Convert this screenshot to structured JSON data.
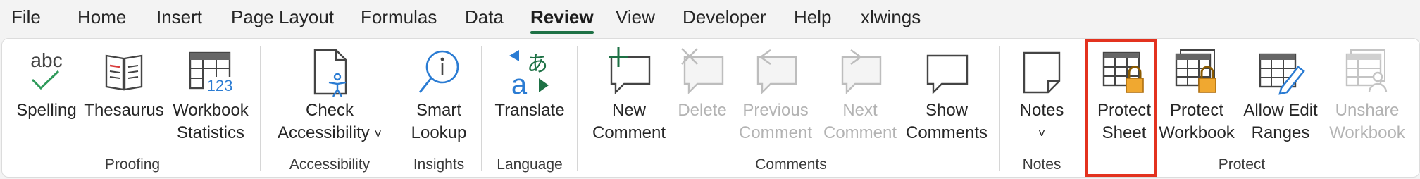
{
  "tabs": [
    {
      "label": "File"
    },
    {
      "label": "Home"
    },
    {
      "label": "Insert"
    },
    {
      "label": "Page Layout"
    },
    {
      "label": "Formulas"
    },
    {
      "label": "Data"
    },
    {
      "label": "Review"
    },
    {
      "label": "View"
    },
    {
      "label": "Developer"
    },
    {
      "label": "Help"
    },
    {
      "label": "xlwings"
    }
  ],
  "active_tab": "Review",
  "colors": {
    "accent": "#1e7145",
    "highlight": "#e3321f",
    "lock": "#f0a830",
    "icon_blue": "#2b7cd3"
  },
  "groups": {
    "proofing": {
      "label": "Proofing",
      "spelling": {
        "line1": "Spelling",
        "icon_text": "abc",
        "icon": "spelling-check-icon"
      },
      "thesaurus": {
        "line1": "Thesaurus",
        "icon": "book-icon"
      },
      "workbook_statistics": {
        "line1": "Workbook",
        "line2": "Statistics",
        "icon_text": "123",
        "icon": "grid-stats-icon"
      }
    },
    "accessibility": {
      "label": "Accessibility",
      "check_accessibility": {
        "line1": "Check",
        "line2": "Accessibility",
        "caret": "˅",
        "icon": "accessibility-document-icon"
      }
    },
    "insights": {
      "label": "Insights",
      "smart_lookup": {
        "line1": "Smart",
        "line2": "Lookup",
        "icon": "magnifier-info-icon"
      }
    },
    "language": {
      "label": "Language",
      "translate": {
        "line1": "Translate",
        "icon_text_a": "a",
        "icon_text_b": "あ",
        "icon": "translate-icon"
      }
    },
    "comments": {
      "label": "Comments",
      "new_comment": {
        "line1": "New",
        "line2": "Comment",
        "disabled": false,
        "icon": "new-comment-icon"
      },
      "delete": {
        "line1": "Delete",
        "disabled": true,
        "icon": "delete-comment-icon"
      },
      "previous_comment": {
        "line1": "Previous",
        "line2": "Comment",
        "disabled": true,
        "icon": "previous-comment-icon"
      },
      "next_comment": {
        "line1": "Next",
        "line2": "Comment",
        "disabled": true,
        "icon": "next-comment-icon"
      },
      "show_comments": {
        "line1": "Show",
        "line2": "Comments",
        "disabled": false,
        "icon": "comment-bubble-icon"
      }
    },
    "notes": {
      "label": "Notes",
      "notes": {
        "line1": "Notes",
        "caret": "˅",
        "icon": "note-icon"
      }
    },
    "protect": {
      "label": "Protect",
      "protect_sheet": {
        "line1": "Protect",
        "line2": "Sheet",
        "highlighted": true,
        "icon": "sheet-lock-icon"
      },
      "protect_workbook": {
        "line1": "Protect",
        "line2": "Workbook",
        "icon": "workbook-lock-icon"
      },
      "allow_edit_ranges": {
        "line1": "Allow Edit",
        "line2": "Ranges",
        "icon": "grid-pencil-icon"
      },
      "unshare_workbook": {
        "line1": "Unshare",
        "line2": "Workbook",
        "disabled": true,
        "icon": "unshare-workbook-icon"
      }
    }
  }
}
